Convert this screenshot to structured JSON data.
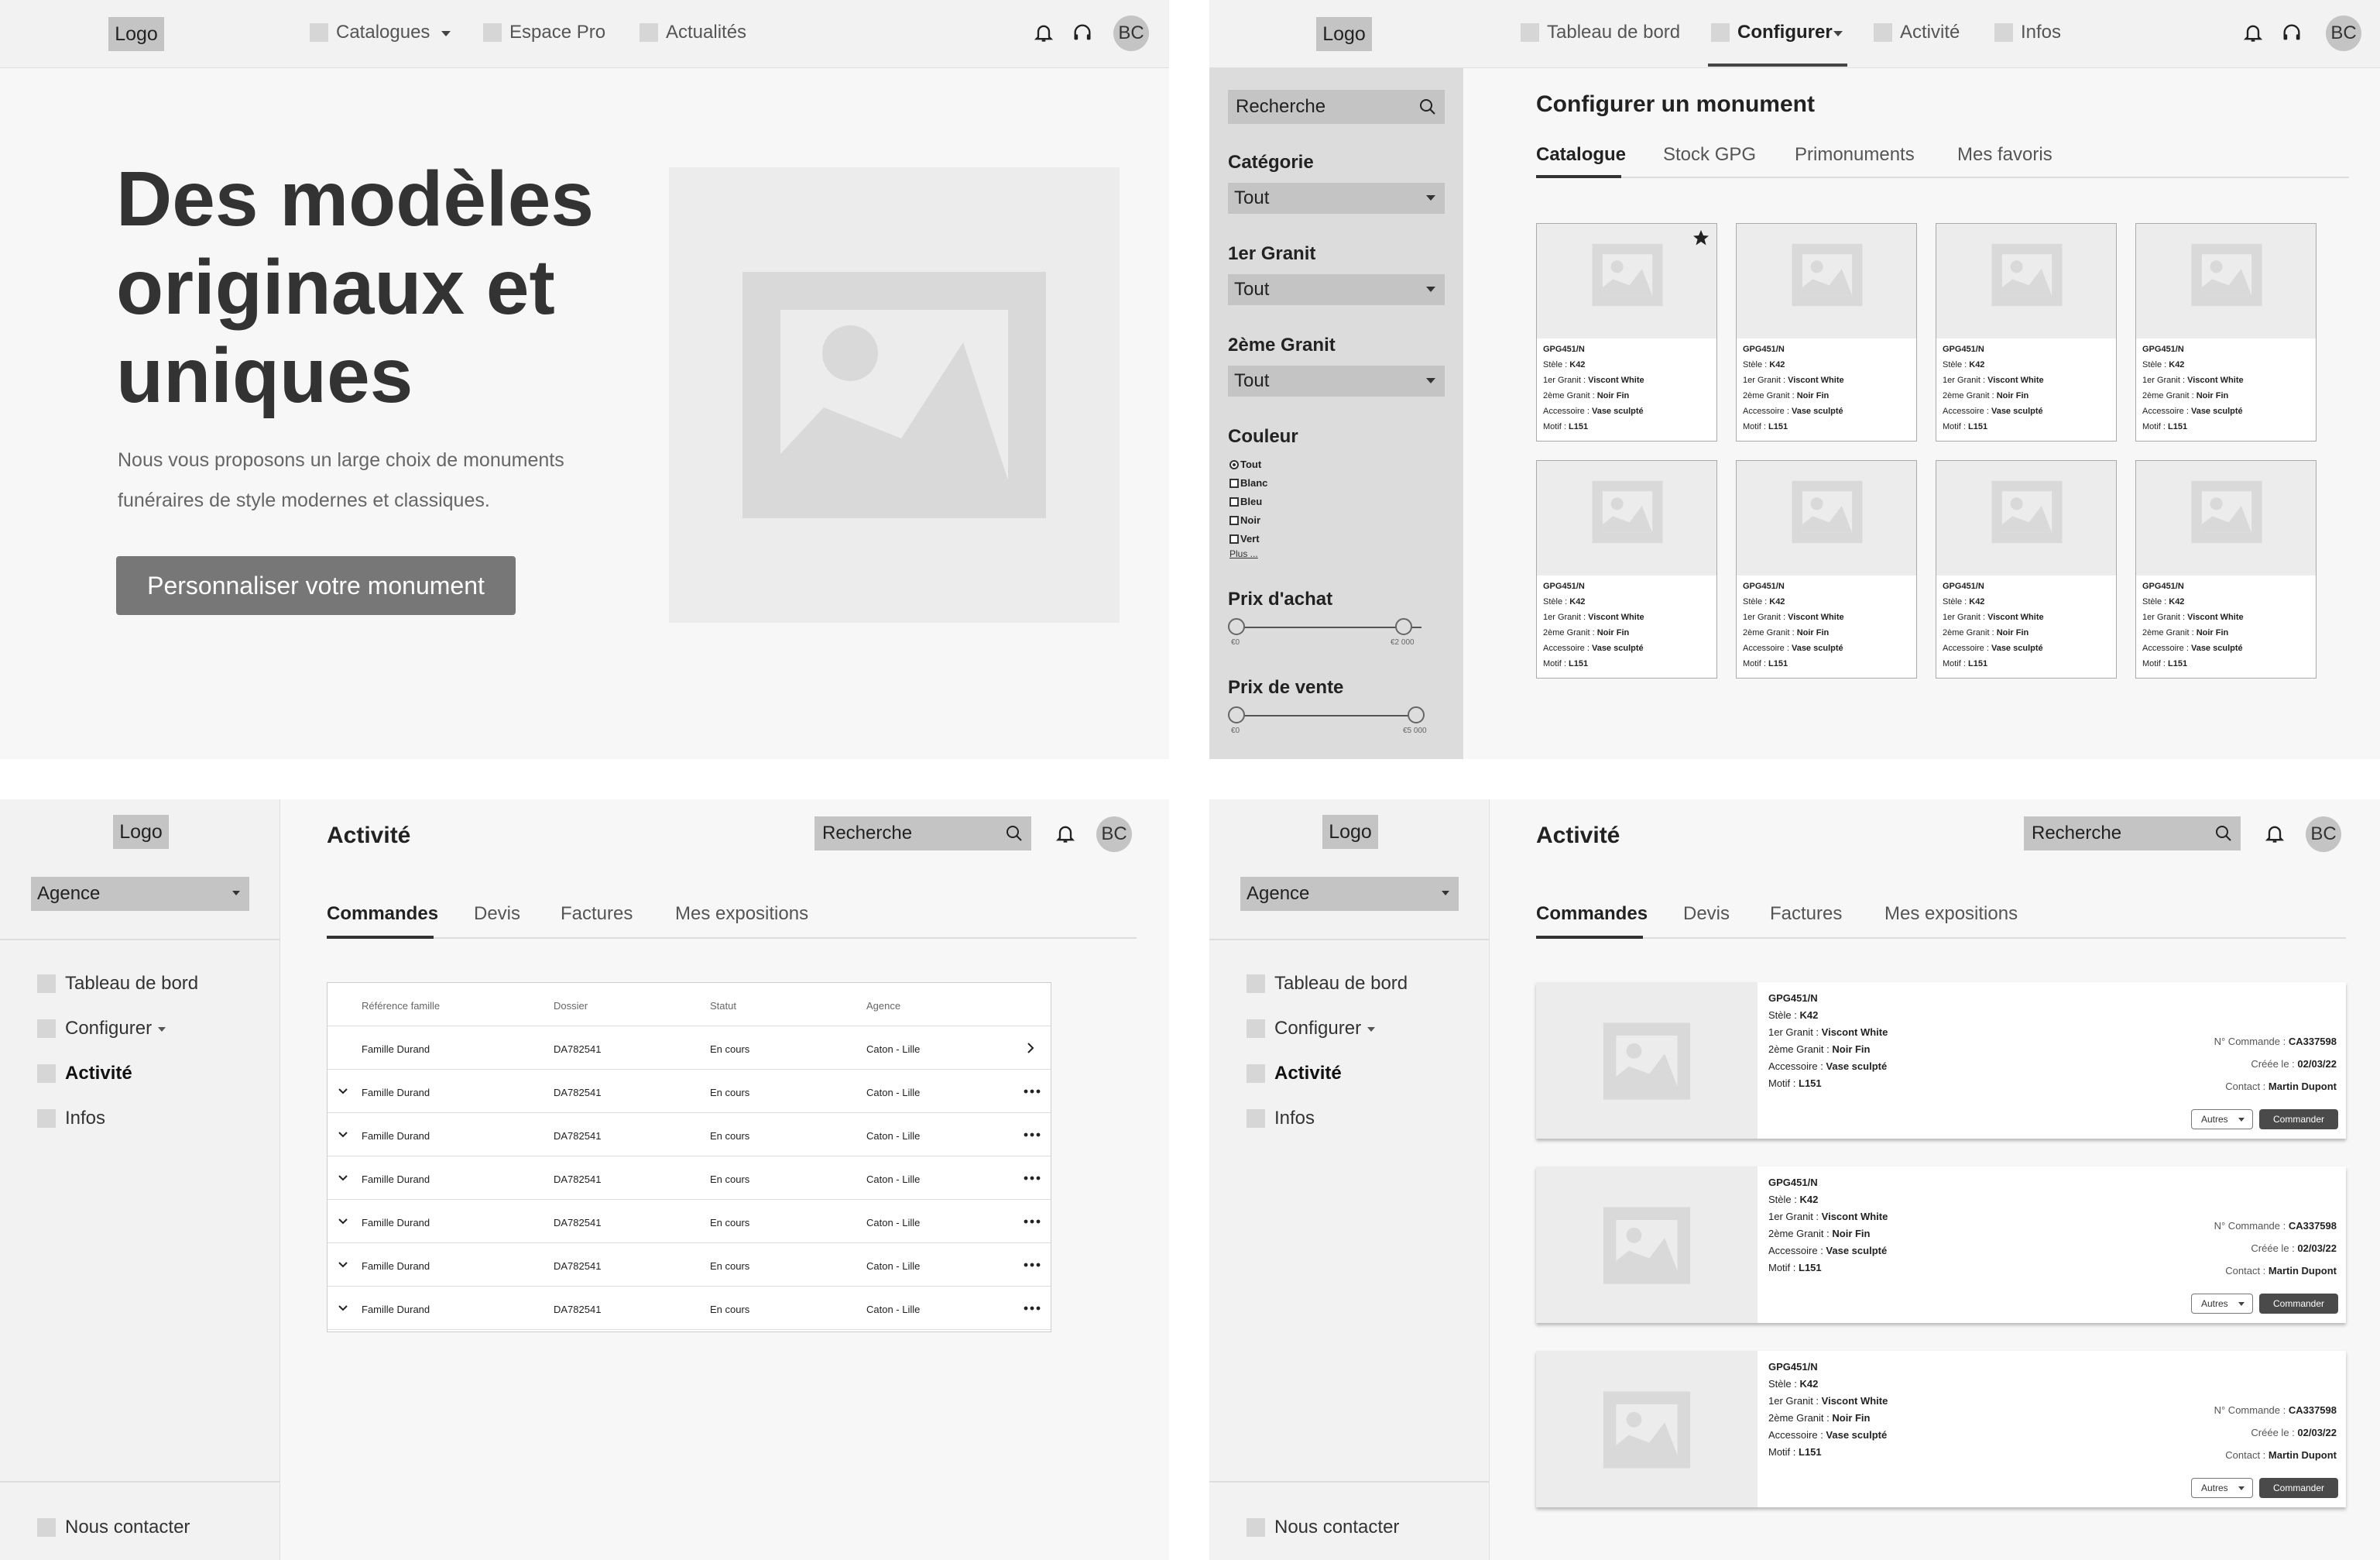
{
  "logo_text": "Logo",
  "avatar_initials": "BC",
  "landing": {
    "nav": [
      "Catalogues",
      "Espace Pro",
      "Actualités"
    ],
    "hero_title": "Des modèles originaux et uniques",
    "hero_subtitle": "Nous vous proposons un large choix de monuments funéraires de style modernes et classiques.",
    "cta_label": "Personnaliser votre monument"
  },
  "configurer": {
    "nav": [
      "Tableau de bord",
      "Configurer",
      "Activité",
      "Infos"
    ],
    "search_placeholder": "Recherche",
    "page_title": "Configurer un monument",
    "tabs": [
      "Catalogue",
      "Stock GPG",
      "Primonuments",
      "Mes favoris"
    ],
    "filters": {
      "categorie_label": "Catégorie",
      "granit1_label": "1er Granit",
      "granit2_label": "2ème Granit",
      "select_value": "Tout",
      "couleur_label": "Couleur",
      "couleurs": [
        "Tout",
        "Blanc",
        "Bleu",
        "Noir",
        "Vert"
      ],
      "couleur_more": "Plus ...",
      "prix_achat_label": "Prix d'achat",
      "prix_achat_min": "€0",
      "prix_achat_max": "€2 000",
      "prix_vente_label": "Prix de vente",
      "prix_vente_min": "€0",
      "prix_vente_max": "€5 000"
    }
  },
  "product": {
    "ref": "GPG451/N",
    "stele_label": "Stèle : ",
    "stele": "K42",
    "granit1_label": "1er Granit : ",
    "granit1": "Viscont White",
    "granit2_label": "2ème Granit : ",
    "granit2": "Noir Fin",
    "accessoire_label": "Accessoire : ",
    "accessoire": "Vase sculpté",
    "motif_label": "Motif : ",
    "motif": "L151"
  },
  "activite": {
    "sidebar_select": "Agence",
    "side_nav": [
      "Tableau de bord",
      "Configurer",
      "Activité",
      "Infos"
    ],
    "contact": "Nous contacter",
    "page_title": "Activité",
    "search_placeholder": "Recherche",
    "tabs": [
      "Commandes",
      "Devis",
      "Factures",
      "Mes expositions"
    ],
    "table_headers": [
      "Référence famille",
      "Dossier",
      "Statut",
      "Agence"
    ],
    "table_rows": [
      [
        "Famille Durand",
        "DA782541",
        "En cours",
        "Caton - Lille"
      ],
      [
        "Famille Durand",
        "DA782541",
        "En cours",
        "Caton - Lille"
      ],
      [
        "Famille Durand",
        "DA782541",
        "En cours",
        "Caton - Lille"
      ],
      [
        "Famille Durand",
        "DA782541",
        "En cours",
        "Caton - Lille"
      ],
      [
        "Famille Durand",
        "DA782541",
        "En cours",
        "Caton - Lille"
      ],
      [
        "Famille Durand",
        "DA782541",
        "En cours",
        "Caton - Lille"
      ],
      [
        "Famille Durand",
        "DA782541",
        "En cours",
        "Caton - Lille"
      ]
    ]
  },
  "order": {
    "numero_label": "N° Commande : ",
    "numero": "CA337598",
    "date_label": "Créée le : ",
    "date": "02/03/22",
    "contact_label": "Contact : ",
    "contact": "Martin Dupont",
    "autres_label": "Autres",
    "commander_label": "Commander"
  }
}
